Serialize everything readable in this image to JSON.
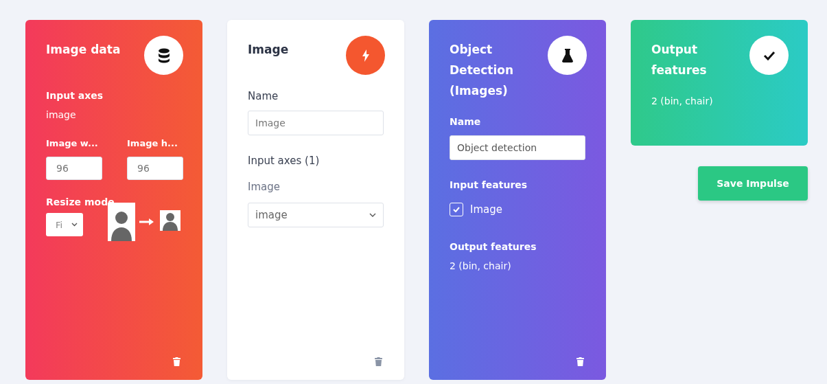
{
  "blocks": [
    {
      "kind": "input",
      "title": "Image data",
      "axes_label": "Input axes",
      "axes_value": "image",
      "width_label": "Image w...",
      "width_value": "96",
      "height_label": "Image h...",
      "height_value": "96",
      "resize_label": "Resize mode",
      "resize_value": "Fi"
    },
    {
      "kind": "processing",
      "title": "Image",
      "name_label": "Name",
      "name_value": "Image",
      "axes_label": "Input axes (1)",
      "axis_label": "Image",
      "axis_value": "image"
    },
    {
      "kind": "learning",
      "title": "Object Detection (Images)",
      "name_label": "Name",
      "name_value": "Object detection",
      "input_label": "Input features",
      "features": [
        {
          "label": "Image",
          "checked": true
        }
      ],
      "output_label": "Output features",
      "output_value": "2 (bin, chair)"
    },
    {
      "kind": "output",
      "title": "Output features",
      "output_value": "2 (bin, chair)"
    }
  ],
  "save_button": "Save Impulse"
}
